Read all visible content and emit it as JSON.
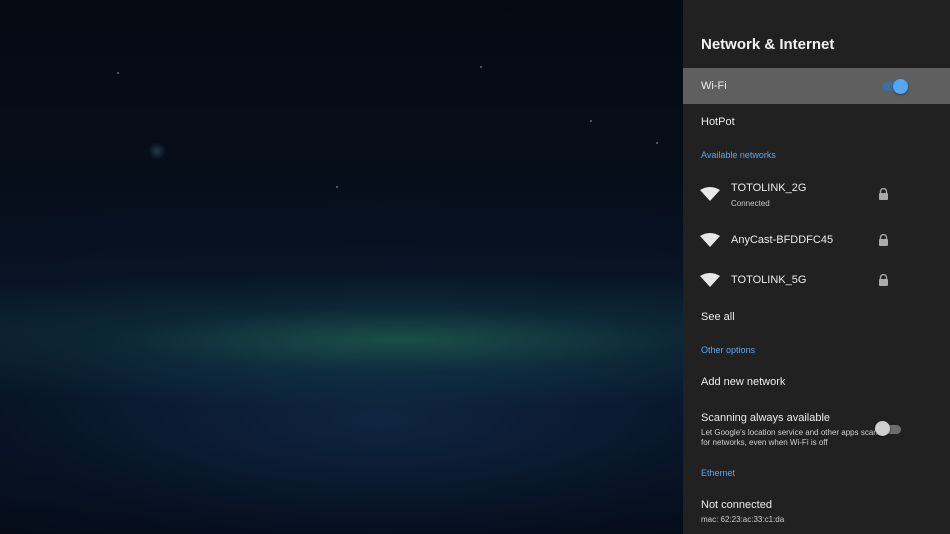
{
  "panel": {
    "title": "Network & Internet",
    "wifi": {
      "label": "Wi-Fi",
      "enabled": true
    },
    "hotspot": {
      "label": "HotPot"
    },
    "available_header": "Available networks",
    "networks": [
      {
        "name": "TOTOLINK_2G",
        "status": "Connected",
        "icon": "wifi-icon",
        "secured": true
      },
      {
        "name": "AnyCast-BFDDFC45",
        "status": "",
        "icon": "wifi-icon",
        "secured": true
      },
      {
        "name": "TOTOLINK_5G",
        "status": "",
        "icon": "wifi-icon",
        "secured": true
      }
    ],
    "see_all": "See all",
    "other_header": "Other options",
    "add_network": "Add new network",
    "scanning": {
      "label": "Scanning always available",
      "description": "Let Google's location service and other apps scan for networks, even when Wi-Fi is off",
      "enabled": false
    },
    "ethernet_header": "Ethernet",
    "ethernet": {
      "status": "Not connected",
      "mac": "mac: 62:23:ac:33:c1:da"
    }
  },
  "colors": {
    "panel_bg": "#212121",
    "selected_row": "#5f5f5f",
    "accent": "#58a9f4"
  }
}
